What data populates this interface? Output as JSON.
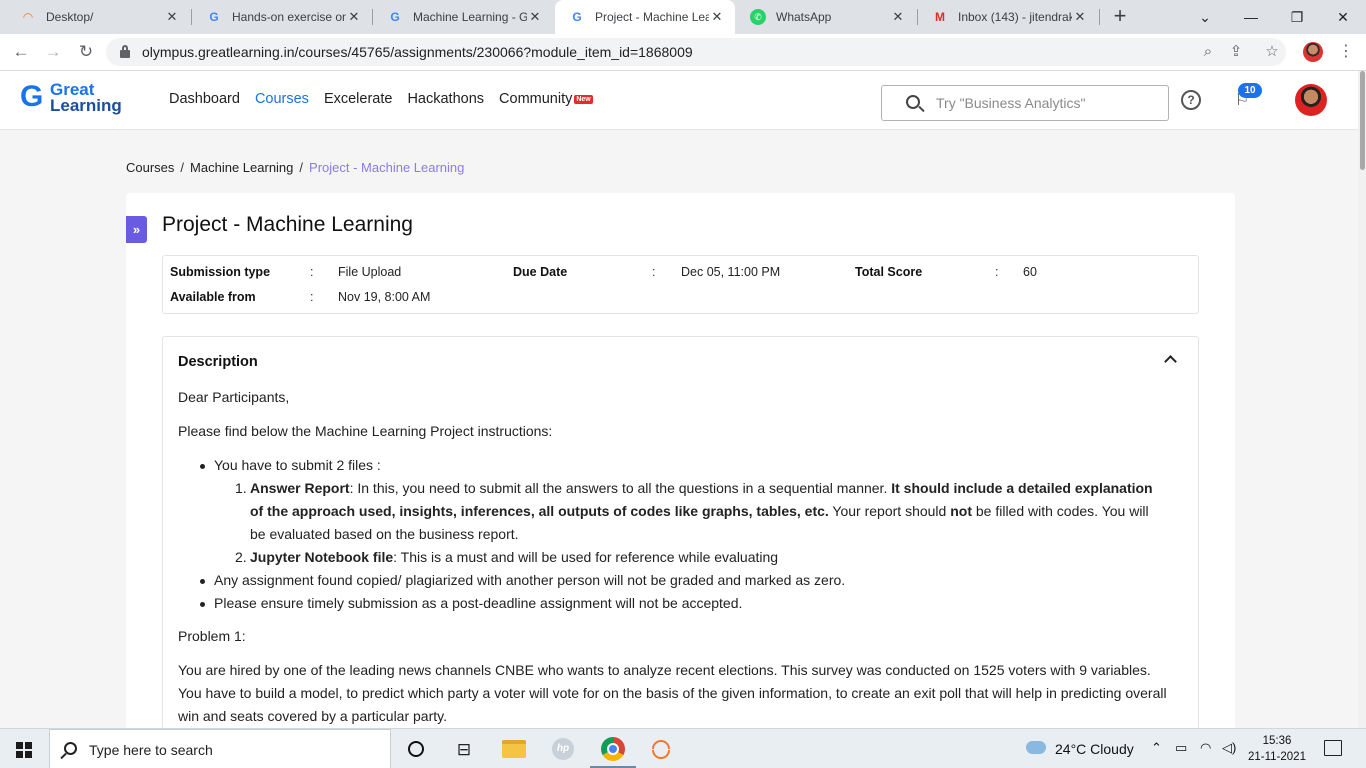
{
  "browser": {
    "tabs": [
      {
        "title": "Desktop/",
        "icon": "jupyter-tab-icon"
      },
      {
        "title": "Hands-on exercise on",
        "icon": "google-icon"
      },
      {
        "title": "Machine Learning - G",
        "icon": "google-icon"
      },
      {
        "title": "Project - Machine Lea",
        "icon": "google-icon",
        "active": true
      },
      {
        "title": "WhatsApp",
        "icon": "whatsapp-icon"
      },
      {
        "title": "Inbox (143) - jitendrak",
        "icon": "gmail-icon"
      }
    ],
    "url": "olympus.greatlearning.in/courses/45765/assignments/230066?module_item_id=1868009"
  },
  "site": {
    "logo_line1": "Great",
    "logo_line2": "Learning",
    "nav": [
      "Dashboard",
      "Courses",
      "Excelerate",
      "Hackathons",
      "Community"
    ],
    "new_badge": "New",
    "search_placeholder": "Try \"Business Analytics\"",
    "notification_count": "10"
  },
  "breadcrumb": {
    "items": [
      "Courses",
      "Machine Learning"
    ],
    "current": "Project - Machine Learning",
    "separator": "/"
  },
  "assignment": {
    "title": "Project - Machine Learning",
    "submission_type_label": "Submission type",
    "submission_type": "File Upload",
    "due_date_label": "Due Date",
    "due_date": "Dec 05, 11:00 PM",
    "total_score_label": "Total Score",
    "total_score": "60",
    "available_from_label": "Available from",
    "available_from": "Nov 19, 8:00 AM",
    "colon": ":"
  },
  "description": {
    "heading": "Description",
    "greeting": "Dear Participants,",
    "intro": "Please find below the Machine Learning Project instructions:",
    "bullet1": "You have to submit 2 files :",
    "item1_num": "1.",
    "item1_bold": "Answer Report",
    "item1_text1": ": In this, you need to submit all the answers to all the questions in a sequential manner. ",
    "item1_bold2": "It should include a detailed explanation of the approach used, insights, inferences, all outputs of codes like graphs, tables, etc.",
    "item1_text2": " Your report should ",
    "item1_bold3": "not",
    "item1_text3": " be filled with codes. You will be evaluated based on the business report.",
    "item2_num": "2.",
    "item2_bold": "Jupyter Notebook file",
    "item2_text": ": This is a must and will be used for reference while evaluating",
    "bullet2": "Any assignment found copied/ plagiarized with another person will not be graded and marked as zero.",
    "bullet3": "Please ensure timely submission as a post-deadline assignment will not be accepted.",
    "problem_heading": "Problem 1:",
    "problem_text": "You are hired by one of the leading news channels CNBE who wants to analyze recent elections. This survey was conducted on 1525 voters with 9 variables. You have to build a model, to predict which party a voter will vote for on the basis of the given information, to create an exit poll that will help in predicting overall win and seats covered by a particular party."
  },
  "taskbar": {
    "search_placeholder": "Type here to search",
    "weather": "24°C  Cloudy",
    "time": "15:36",
    "date": "21-11-2021"
  },
  "colors": {
    "accent": "#1a73e8",
    "breadcrumb_current": "#8c7be8",
    "expand_button": "#6a5be3"
  }
}
